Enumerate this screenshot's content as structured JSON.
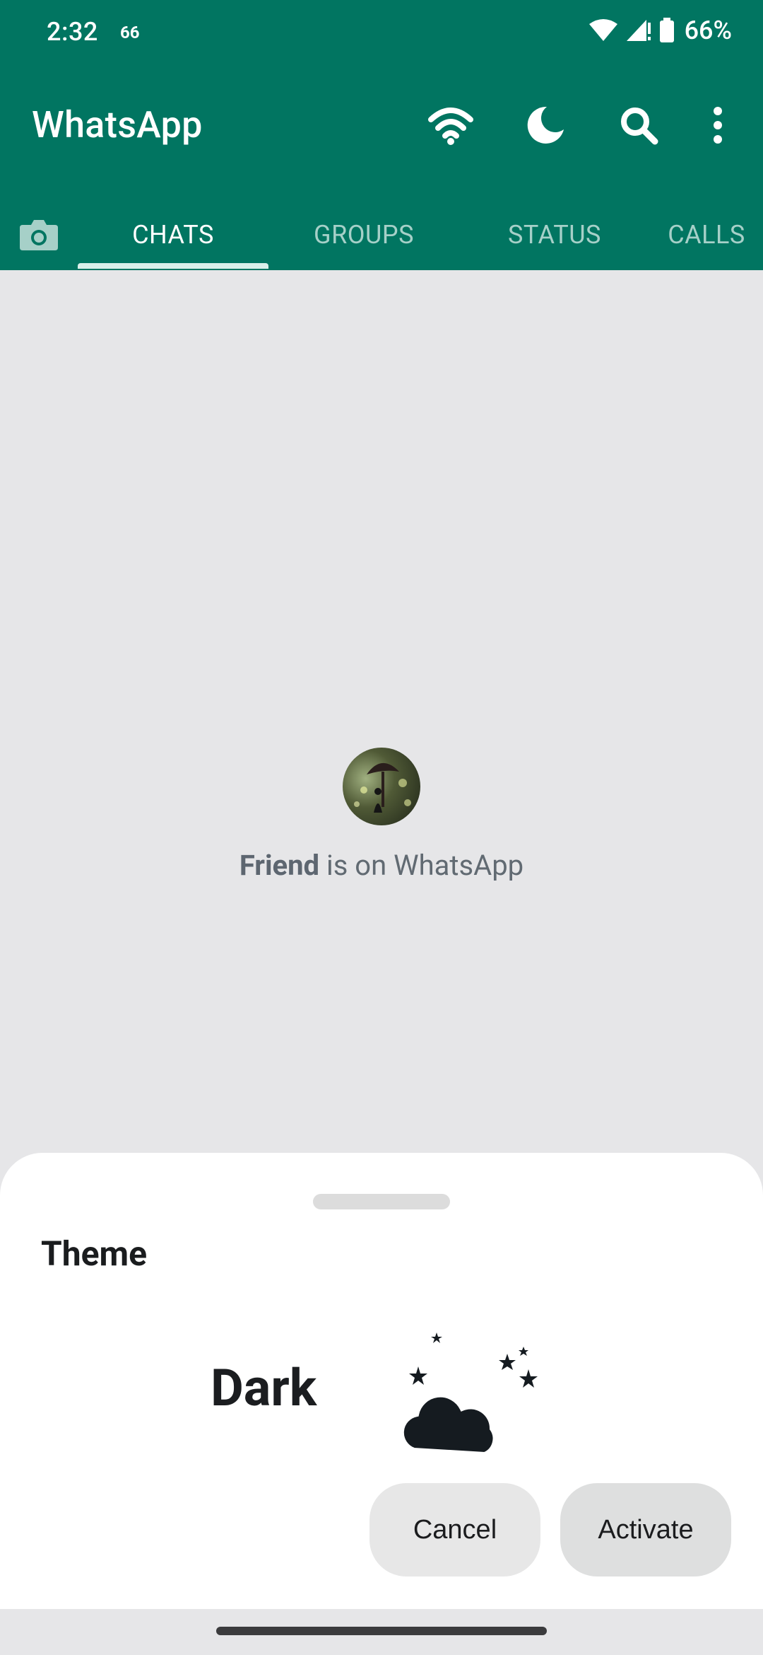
{
  "status_bar": {
    "time": "2:32",
    "notification": "66",
    "battery": "66%"
  },
  "app": {
    "title": "WhatsApp"
  },
  "actions": {
    "wifi_icon": "wifi-icon",
    "dark_mode_icon": "moon-icon",
    "search_icon": "search-icon",
    "more_icon": "more-vert-icon"
  },
  "tabs": [
    {
      "label": "CHATS",
      "selected": true
    },
    {
      "label": "GROUPS",
      "selected": false
    },
    {
      "label": "STATUS",
      "selected": false
    },
    {
      "label": "CALLS",
      "selected": false
    }
  ],
  "empty_state": {
    "name": "Friend",
    "suffix": " is on WhatsApp"
  },
  "sheet": {
    "title": "Theme",
    "theme_name": "Dark",
    "cancel_label": "Cancel",
    "activate_label": "Activate"
  },
  "colors": {
    "primary": "#017561",
    "background": "#e6e6e8",
    "sheet": "#ffffff"
  }
}
